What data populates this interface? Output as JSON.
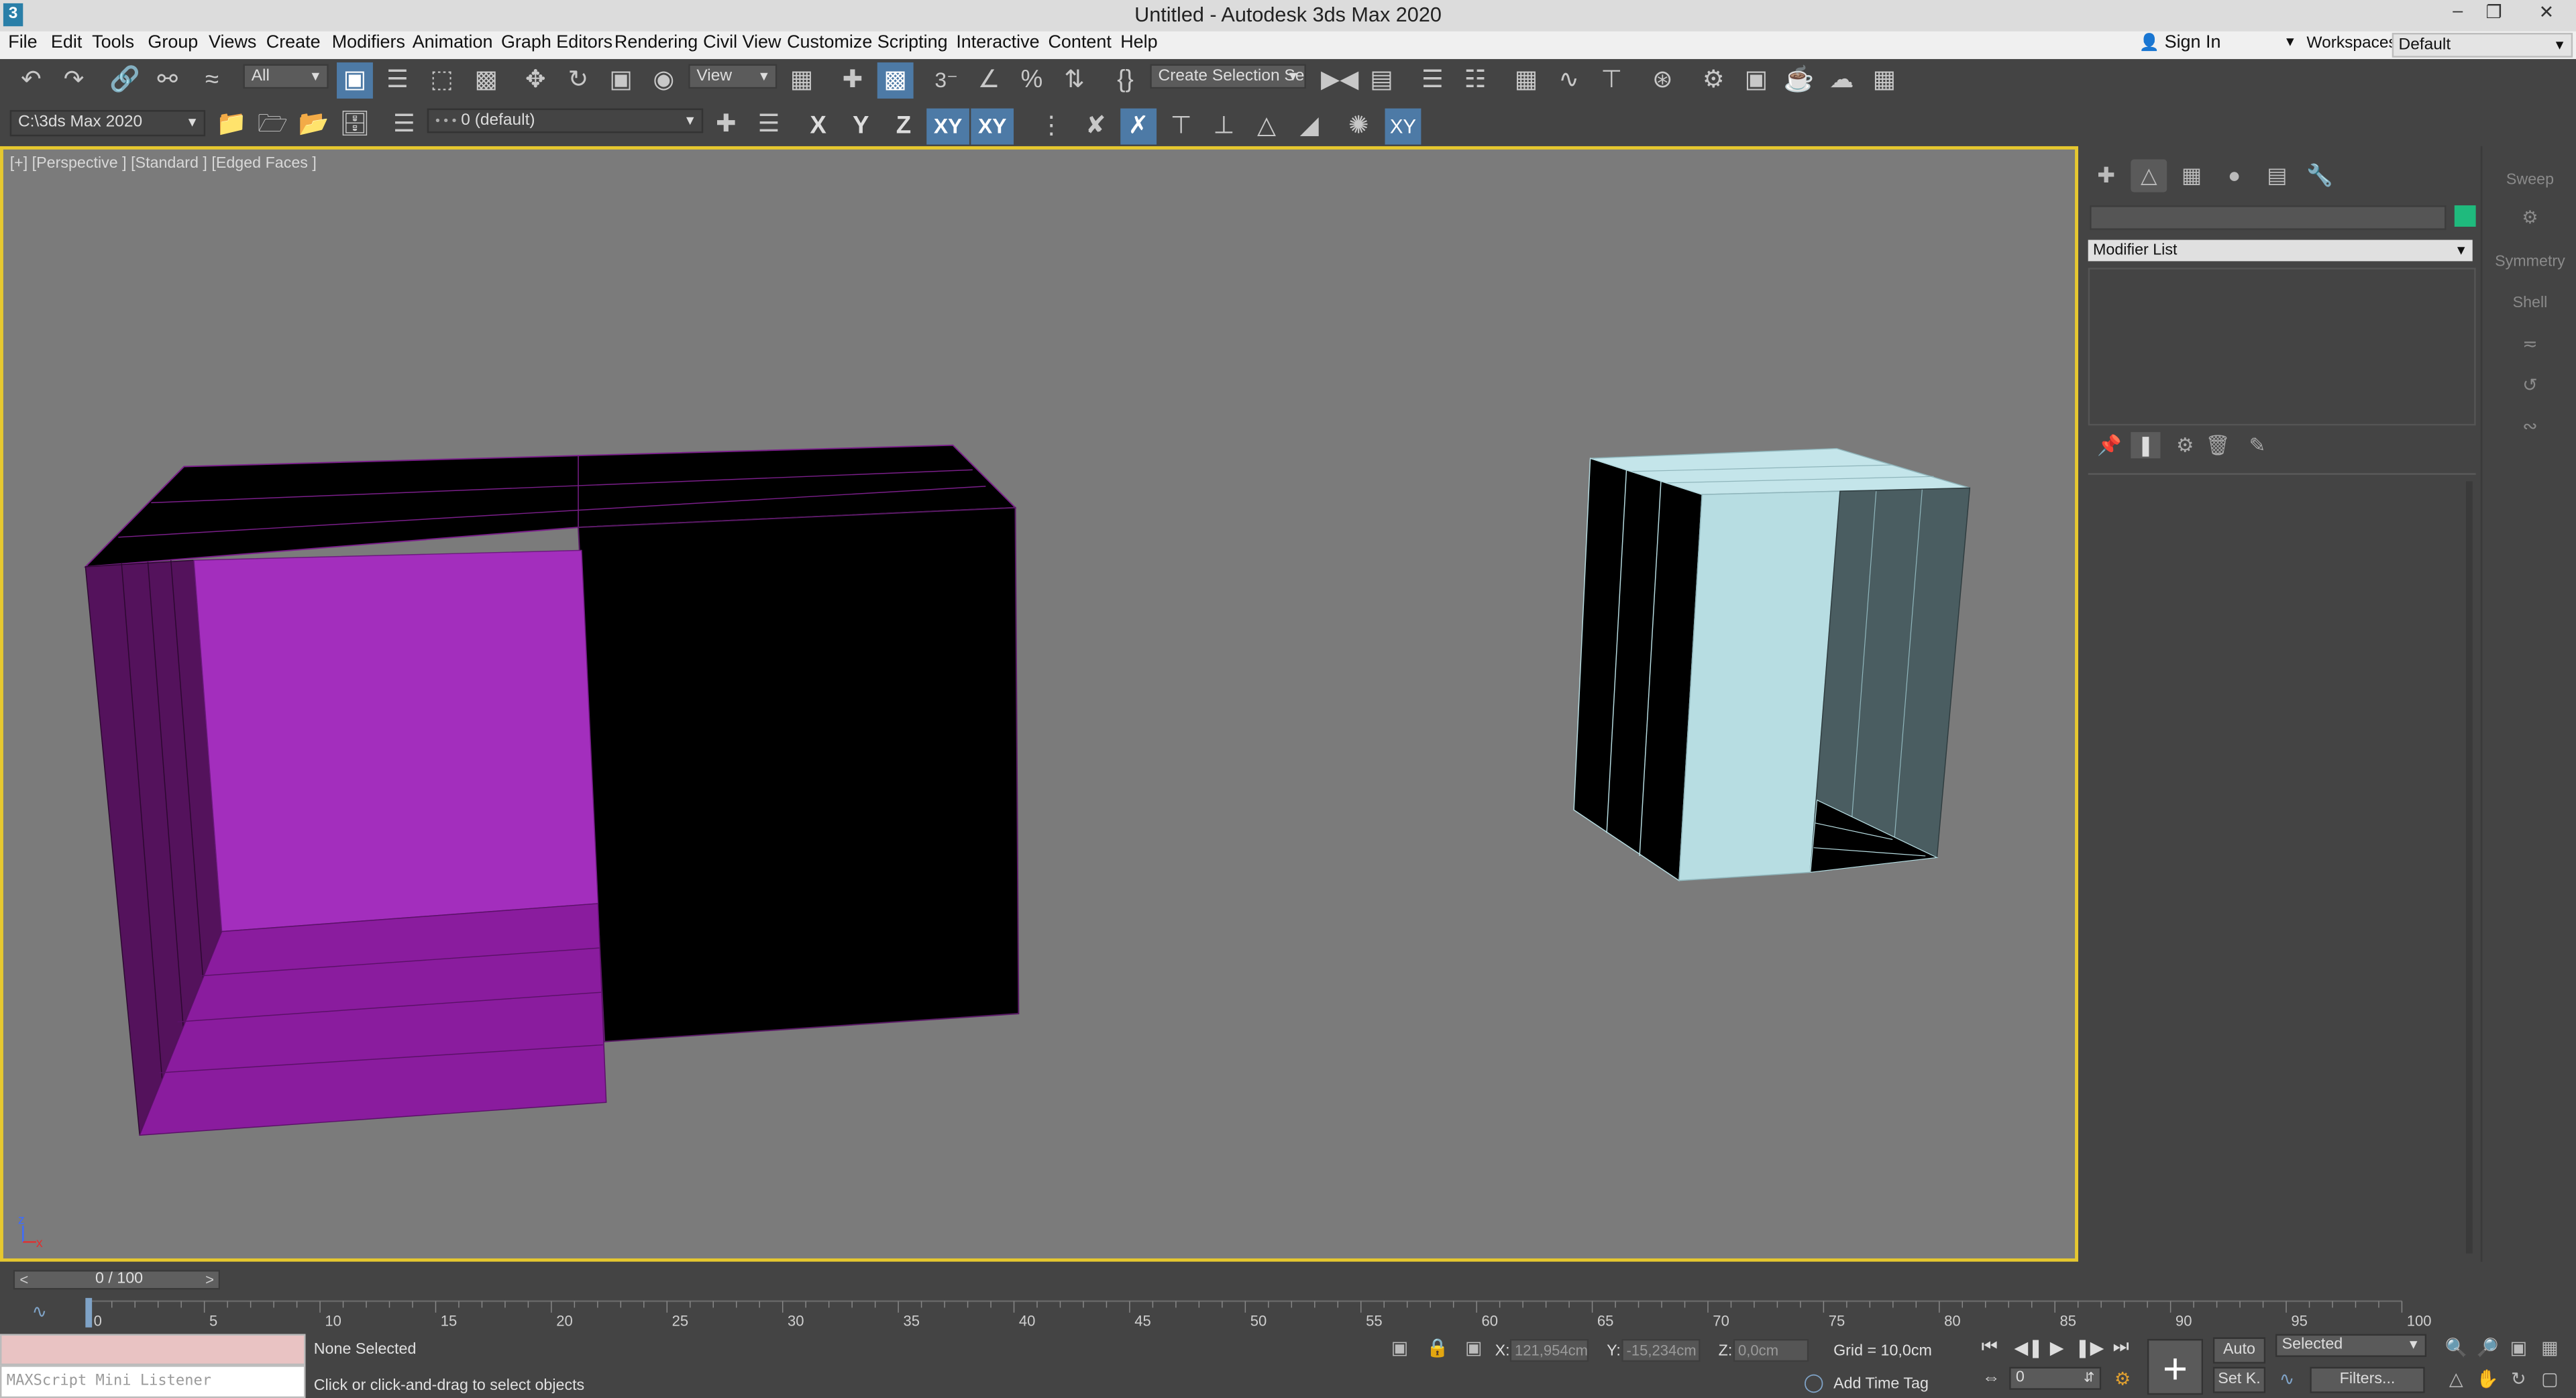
{
  "window": {
    "app_icon": "3",
    "title": "Untitled - Autodesk 3ds Max 2020",
    "controls": [
      "minimize-icon",
      "restore-icon",
      "close-icon"
    ]
  },
  "menubar": {
    "items": [
      "File",
      "Edit",
      "Tools",
      "Group",
      "Views",
      "Create",
      "Modifiers",
      "Animation",
      "Graph Editors",
      "Rendering",
      "Civil View",
      "Customize",
      "Scripting",
      "Interactive",
      "Content",
      "Help"
    ],
    "sign_in": "Sign In",
    "workspaces_label": "Workspaces:",
    "workspace_value": "Default"
  },
  "toolbar": {
    "selection_filter": "All",
    "reference_coord": "View",
    "named_selection": "Create Selection Set",
    "project_path": "C:\\3ds Max 2020",
    "layer": "0 (default)",
    "axes": [
      "X",
      "Y",
      "Z",
      "XY",
      "XY"
    ]
  },
  "viewport": {
    "label": "[+] [Perspective ] [Standard ] [Edged Faces ]",
    "gizmo_label": "z x",
    "objects": [
      "magenta-open-box",
      "light-blue-open-box"
    ],
    "colors": {
      "background": "#7b7b7b",
      "border": "#e6c82f",
      "magenta": "#9b1fb0",
      "lightblue": "#b7dde2"
    }
  },
  "command_panel": {
    "tabs": [
      "create-icon",
      "modify-icon",
      "hierarchy-icon",
      "motion-icon",
      "display-icon",
      "utilities-icon"
    ],
    "object_color": "#1fba7d",
    "modifier_list": "Modifier List"
  },
  "quick_modifiers": {
    "items": [
      "Sweep",
      "Symmetry",
      "Shell"
    ]
  },
  "timeline": {
    "frame_display": "0 / 100",
    "prev": "<",
    "next": ">",
    "ticks": [
      "0",
      "5",
      "10",
      "15",
      "20",
      "25",
      "30",
      "35",
      "40",
      "45",
      "50",
      "55",
      "60",
      "65",
      "70",
      "75",
      "80",
      "85",
      "90",
      "95",
      "100"
    ]
  },
  "status": {
    "listener_placeholder": "MAXScript Mini Listener",
    "selection": "None Selected",
    "prompt": "Click or click-and-drag to select objects",
    "x_label": "X:",
    "x_value": "121,954cm",
    "y_label": "Y:",
    "y_value": "-15,234cm",
    "z_label": "Z:",
    "z_value": "0,0cm",
    "grid": "Grid = 10,0cm",
    "add_time_tag": "Add Time Tag",
    "auto_key": "Auto",
    "set_key": "Set K.",
    "key_filter_value": "Selected",
    "filters": "Filters...",
    "frame_value": "0"
  }
}
